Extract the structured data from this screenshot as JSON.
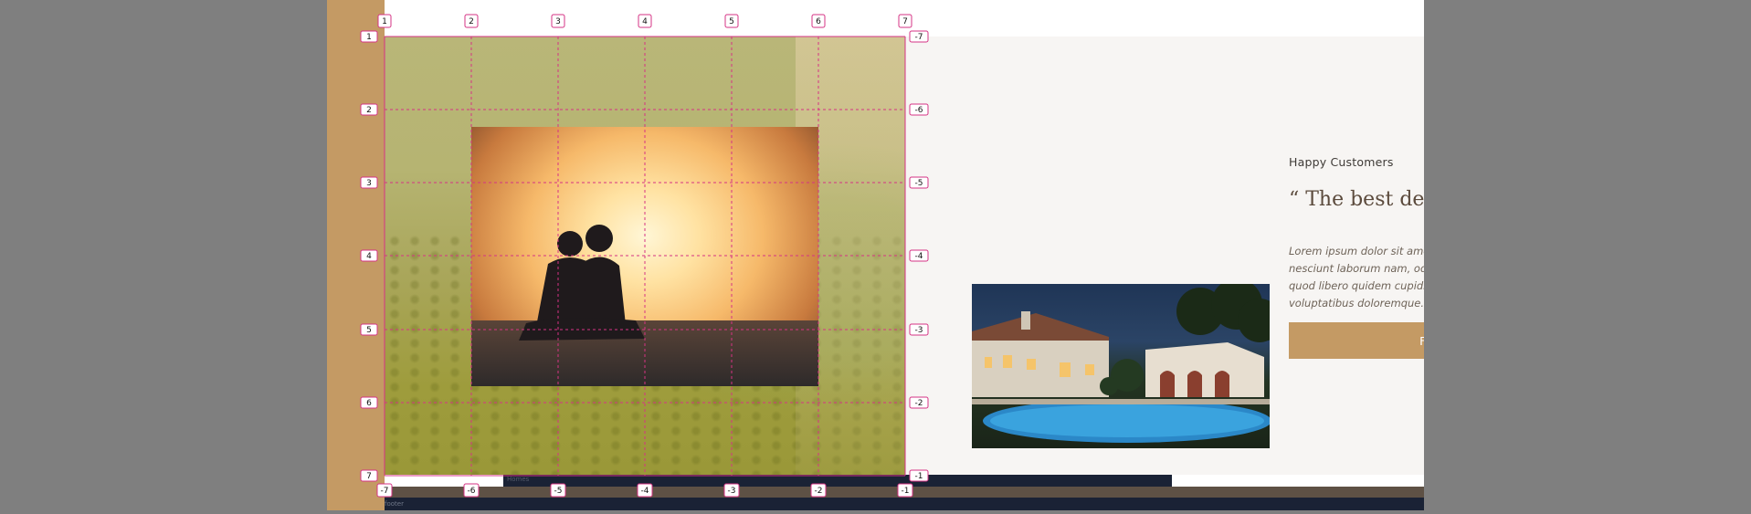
{
  "testimonial": {
    "eyebrow": "Happy Customers",
    "headline": "“ The best decision of our lives ”",
    "body": "Lorem ipsum dolor sit amet consectetur, adipisicing elit. Soluta fugiat nesciunt laborum nam, odio necessitatibus eius quae perspiciatis commodi quod libero quidem cupiditate id. Reiciendis accusantium numquam ipsum voluptatibus doloremque.",
    "cta_label": "FIND YOUR OWN HOME"
  },
  "sections": {
    "homes_label": "Homes",
    "footer_label": "footer"
  },
  "grid_overlay": {
    "top_labels": [
      "1",
      "2",
      "3",
      "4",
      "5",
      "6",
      "7"
    ],
    "bottom_labels": [
      "-7",
      "-6",
      "-5",
      "-4",
      "-3",
      "-2",
      "-1"
    ],
    "left_labels": [
      "1",
      "2",
      "3",
      "4",
      "5",
      "6",
      "7"
    ],
    "right_labels": [
      "-7",
      "-6",
      "-5",
      "-4",
      "-3",
      "-2",
      "-1"
    ]
  },
  "colors": {
    "accent": "#c49a64",
    "grid_line": "#d63384",
    "dark_navy": "#1a2235",
    "brown": "#5e5145",
    "section_bg": "#f7f5f3"
  }
}
